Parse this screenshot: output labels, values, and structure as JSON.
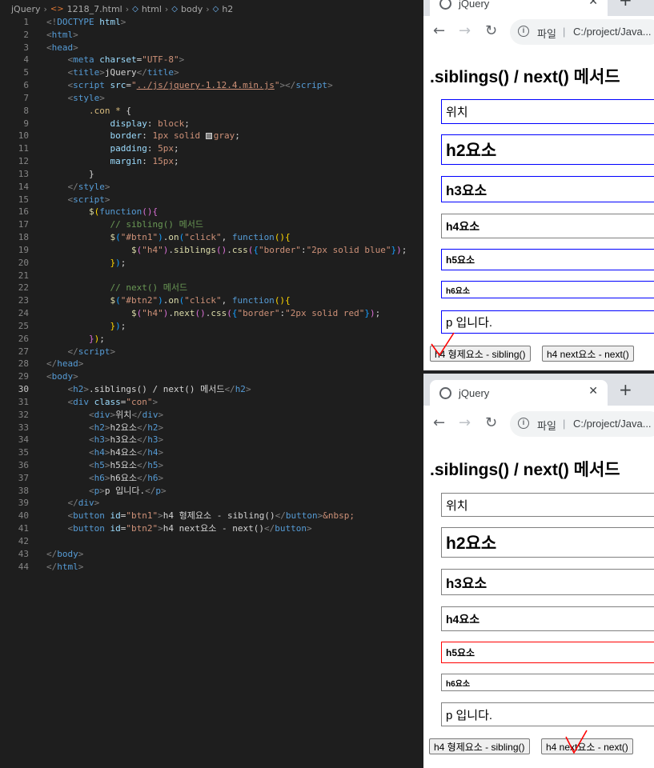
{
  "breadcrumb": [
    "jQuery",
    "1218_7.html",
    "html",
    "body",
    "h2"
  ],
  "code_lines": [
    {
      "n": "1",
      "html": "<span class='t'>&lt;!</span><span class='tn'>DOCTYPE</span> <span class='an'>html</span><span class='t'>&gt;</span>"
    },
    {
      "n": "2",
      "html": "<span class='t'>&lt;</span><span class='tn'>html</span><span class='t'>&gt;</span>"
    },
    {
      "n": "3",
      "html": "<span class='t'>&lt;</span><span class='tn'>head</span><span class='t'>&gt;</span>"
    },
    {
      "n": "4",
      "html": "    <span class='t'>&lt;</span><span class='tn'>meta</span> <span class='an'>charset</span><span class='tx'>=</span><span class='av'>\"UTF-8\"</span><span class='t'>&gt;</span>"
    },
    {
      "n": "5",
      "html": "    <span class='t'>&lt;</span><span class='tn'>title</span><span class='t'>&gt;</span><span class='tx'>jQuery</span><span class='t'>&lt;/</span><span class='tn'>title</span><span class='t'>&gt;</span>"
    },
    {
      "n": "6",
      "html": "    <span class='t'>&lt;</span><span class='tn'>script</span> <span class='an'>src</span><span class='tx'>=</span><span class='av'>\"<span class='u'>../js/jquery-1.12.4.min.js</span>\"</span><span class='t'>&gt;&lt;/</span><span class='tn'>script</span><span class='t'>&gt;</span>"
    },
    {
      "n": "7",
      "html": "    <span class='t'>&lt;</span><span class='tn'>style</span><span class='t'>&gt;</span>"
    },
    {
      "n": "8",
      "html": "        <span class='sel'>.con *</span> <span class='tx'>{</span>"
    },
    {
      "n": "9",
      "html": "            <span class='pr'>display</span><span class='tx'>: </span><span class='cv'>block</span><span class='tx'>;</span>"
    },
    {
      "n": "10",
      "html": "            <span class='pr'>border</span><span class='tx'>: </span><span class='cv'>1px solid </span><span class='swatch'></span><span class='cv'>gray</span><span class='tx'>;</span>"
    },
    {
      "n": "11",
      "html": "            <span class='pr'>padding</span><span class='tx'>: </span><span class='cv'>5px</span><span class='tx'>;</span>"
    },
    {
      "n": "12",
      "html": "            <span class='pr'>margin</span><span class='tx'>: </span><span class='cv'>15px</span><span class='tx'>;</span>"
    },
    {
      "n": "13",
      "html": "        <span class='tx'>}</span>"
    },
    {
      "n": "14",
      "html": "    <span class='t'>&lt;/</span><span class='tn'>style</span><span class='t'>&gt;</span>"
    },
    {
      "n": "15",
      "html": "    <span class='t'>&lt;</span><span class='tn'>script</span><span class='t'>&gt;</span>"
    },
    {
      "n": "16",
      "html": "        <span class='fn'>$</span><span class='p1'>(</span><span class='kw'>function</span><span class='p2'>()</span><span class='p2'>{</span>"
    },
    {
      "n": "17",
      "html": "            <span class='cm'>// sibling() 메서드</span>"
    },
    {
      "n": "18",
      "html": "            <span class='fn'>$</span><span class='p3'>(</span><span class='av'>\"#btn1\"</span><span class='p3'>)</span><span class='tx'>.</span><span class='fn'>on</span><span class='p3'>(</span><span class='av'>\"click\"</span><span class='tx'>, </span><span class='kw'>function</span><span class='p1'>()</span><span class='p1'>{</span>"
    },
    {
      "n": "19",
      "html": "                <span class='fn'>$</span><span class='p2'>(</span><span class='av'>\"h4\"</span><span class='p2'>)</span><span class='tx'>.</span><span class='fn'>siblings</span><span class='p2'>()</span><span class='tx'>.</span><span class='fn'>css</span><span class='p2'>(</span><span class='p3'>{</span><span class='av'>\"border\"</span><span class='tx'>:</span><span class='av'>\"2px solid blue\"</span><span class='p3'>}</span><span class='p2'>)</span><span class='tx'>;</span>"
    },
    {
      "n": "20",
      "html": "            <span class='p1'>}</span><span class='p3'>)</span><span class='tx'>;</span>"
    },
    {
      "n": "21",
      "html": ""
    },
    {
      "n": "22",
      "html": "            <span class='cm'>// next() 메서드</span>"
    },
    {
      "n": "23",
      "html": "            <span class='fn'>$</span><span class='p3'>(</span><span class='av'>\"#btn2\"</span><span class='p3'>)</span><span class='tx'>.</span><span class='fn'>on</span><span class='p3'>(</span><span class='av'>\"click\"</span><span class='tx'>, </span><span class='kw'>function</span><span class='p1'>()</span><span class='p1'>{</span>"
    },
    {
      "n": "24",
      "html": "                <span class='fn'>$</span><span class='p2'>(</span><span class='av'>\"h4\"</span><span class='p2'>)</span><span class='tx'>.</span><span class='fn'>next</span><span class='p2'>()</span><span class='tx'>.</span><span class='fn'>css</span><span class='p2'>(</span><span class='p3'>{</span><span class='av'>\"border\"</span><span class='tx'>:</span><span class='av'>\"2px solid red\"</span><span class='p3'>}</span><span class='p2'>)</span><span class='tx'>;</span>"
    },
    {
      "n": "25",
      "html": "            <span class='p1'>}</span><span class='p3'>)</span><span class='tx'>;</span>"
    },
    {
      "n": "26",
      "html": "        <span class='p2'>}</span><span class='p1'>)</span><span class='tx'>;</span>"
    },
    {
      "n": "27",
      "html": "    <span class='t'>&lt;/</span><span class='tn'>script</span><span class='t'>&gt;</span>"
    },
    {
      "n": "28",
      "html": "<span class='t'>&lt;/</span><span class='tn'>head</span><span class='t'>&gt;</span>"
    },
    {
      "n": "29",
      "html": "<span class='t'>&lt;</span><span class='tn'>body</span><span class='t'>&gt;</span>"
    },
    {
      "n": "30",
      "html": "    <span class='t'>&lt;</span><span class='tn'>h2</span><span class='t'>&gt;</span><span class='tx'>.siblings() / next() 메서드</span><span class='t'>&lt;/</span><span class='tn'>h2</span><span class='t'>&gt;</span>"
    },
    {
      "n": "31",
      "html": "    <span class='t'>&lt;</span><span class='tn'>div</span> <span class='an'>class</span><span class='tx'>=</span><span class='av'>\"con\"</span><span class='t'>&gt;</span>"
    },
    {
      "n": "32",
      "html": "        <span class='t'>&lt;</span><span class='tn'>div</span><span class='t'>&gt;</span><span class='tx'>위치</span><span class='t'>&lt;/</span><span class='tn'>div</span><span class='t'>&gt;</span>"
    },
    {
      "n": "33",
      "html": "        <span class='t'>&lt;</span><span class='tn'>h2</span><span class='t'>&gt;</span><span class='tx'>h2요소</span><span class='t'>&lt;/</span><span class='tn'>h2</span><span class='t'>&gt;</span>"
    },
    {
      "n": "34",
      "html": "        <span class='t'>&lt;</span><span class='tn'>h3</span><span class='t'>&gt;</span><span class='tx'>h3요소</span><span class='t'>&lt;/</span><span class='tn'>h3</span><span class='t'>&gt;</span>"
    },
    {
      "n": "35",
      "html": "        <span class='t'>&lt;</span><span class='tn'>h4</span><span class='t'>&gt;</span><span class='tx'>h4요소</span><span class='t'>&lt;/</span><span class='tn'>h4</span><span class='t'>&gt;</span>"
    },
    {
      "n": "36",
      "html": "        <span class='t'>&lt;</span><span class='tn'>h5</span><span class='t'>&gt;</span><span class='tx'>h5요소</span><span class='t'>&lt;/</span><span class='tn'>h5</span><span class='t'>&gt;</span>"
    },
    {
      "n": "37",
      "html": "        <span class='t'>&lt;</span><span class='tn'>h6</span><span class='t'>&gt;</span><span class='tx'>h6요소</span><span class='t'>&lt;/</span><span class='tn'>h6</span><span class='t'>&gt;</span>"
    },
    {
      "n": "38",
      "html": "        <span class='t'>&lt;</span><span class='tn'>p</span><span class='t'>&gt;</span><span class='tx'>p 입니다.</span><span class='t'>&lt;/</span><span class='tn'>p</span><span class='t'>&gt;</span>"
    },
    {
      "n": "39",
      "html": "    <span class='t'>&lt;/</span><span class='tn'>div</span><span class='t'>&gt;</span>"
    },
    {
      "n": "40",
      "html": "    <span class='t'>&lt;</span><span class='tn'>button</span> <span class='an'>id</span><span class='tx'>=</span><span class='av'>\"btn1\"</span><span class='t'>&gt;</span><span class='tx'>h4 형제요소 - sibling()</span><span class='t'>&lt;/</span><span class='tn'>button</span><span class='t'>&gt;</span><span class='av'>&amp;nbsp;</span>"
    },
    {
      "n": "41",
      "html": "    <span class='t'>&lt;</span><span class='tn'>button</span> <span class='an'>id</span><span class='tx'>=</span><span class='av'>\"btn2\"</span><span class='t'>&gt;</span><span class='tx'>h4 next요소 - next()</span><span class='t'>&lt;/</span><span class='tn'>button</span><span class='t'>&gt;</span>"
    },
    {
      "n": "42",
      "html": ""
    },
    {
      "n": "43",
      "html": "<span class='t'>&lt;/</span><span class='tn'>body</span><span class='t'>&gt;</span>"
    },
    {
      "n": "44",
      "html": "<span class='t'>&lt;/</span><span class='tn'>html</span><span class='t'>&gt;</span>"
    }
  ],
  "current_line": "30",
  "browser": {
    "tab_title": "jQuery",
    "close_glyph": "✕",
    "newtab_glyph": "+",
    "back_glyph": "←",
    "forward_glyph": "→",
    "reload_glyph": "↻",
    "url_protocol": "파일",
    "url_separator": "|",
    "url": "C:/project/Java..."
  },
  "page": {
    "heading": ".siblings() / next() 메서드",
    "items": [
      {
        "tag": "div",
        "text": "위치"
      },
      {
        "tag": "h2",
        "text": "h2요소"
      },
      {
        "tag": "h3",
        "text": "h3요소"
      },
      {
        "tag": "h4",
        "text": "h4요소"
      },
      {
        "tag": "h5",
        "text": "h5요소"
      },
      {
        "tag": "h6",
        "text": "h6요소"
      },
      {
        "tag": "p",
        "text": "p 입니다."
      }
    ],
    "btn1_label": "h4 형제요소 - sibling()",
    "btn2_label": "h4 next요소 - next()"
  },
  "colors": {
    "sibling_border": "#0000ff",
    "next_border": "#ff0000",
    "default_border": "#808080",
    "check_mark": "#ff0000"
  }
}
